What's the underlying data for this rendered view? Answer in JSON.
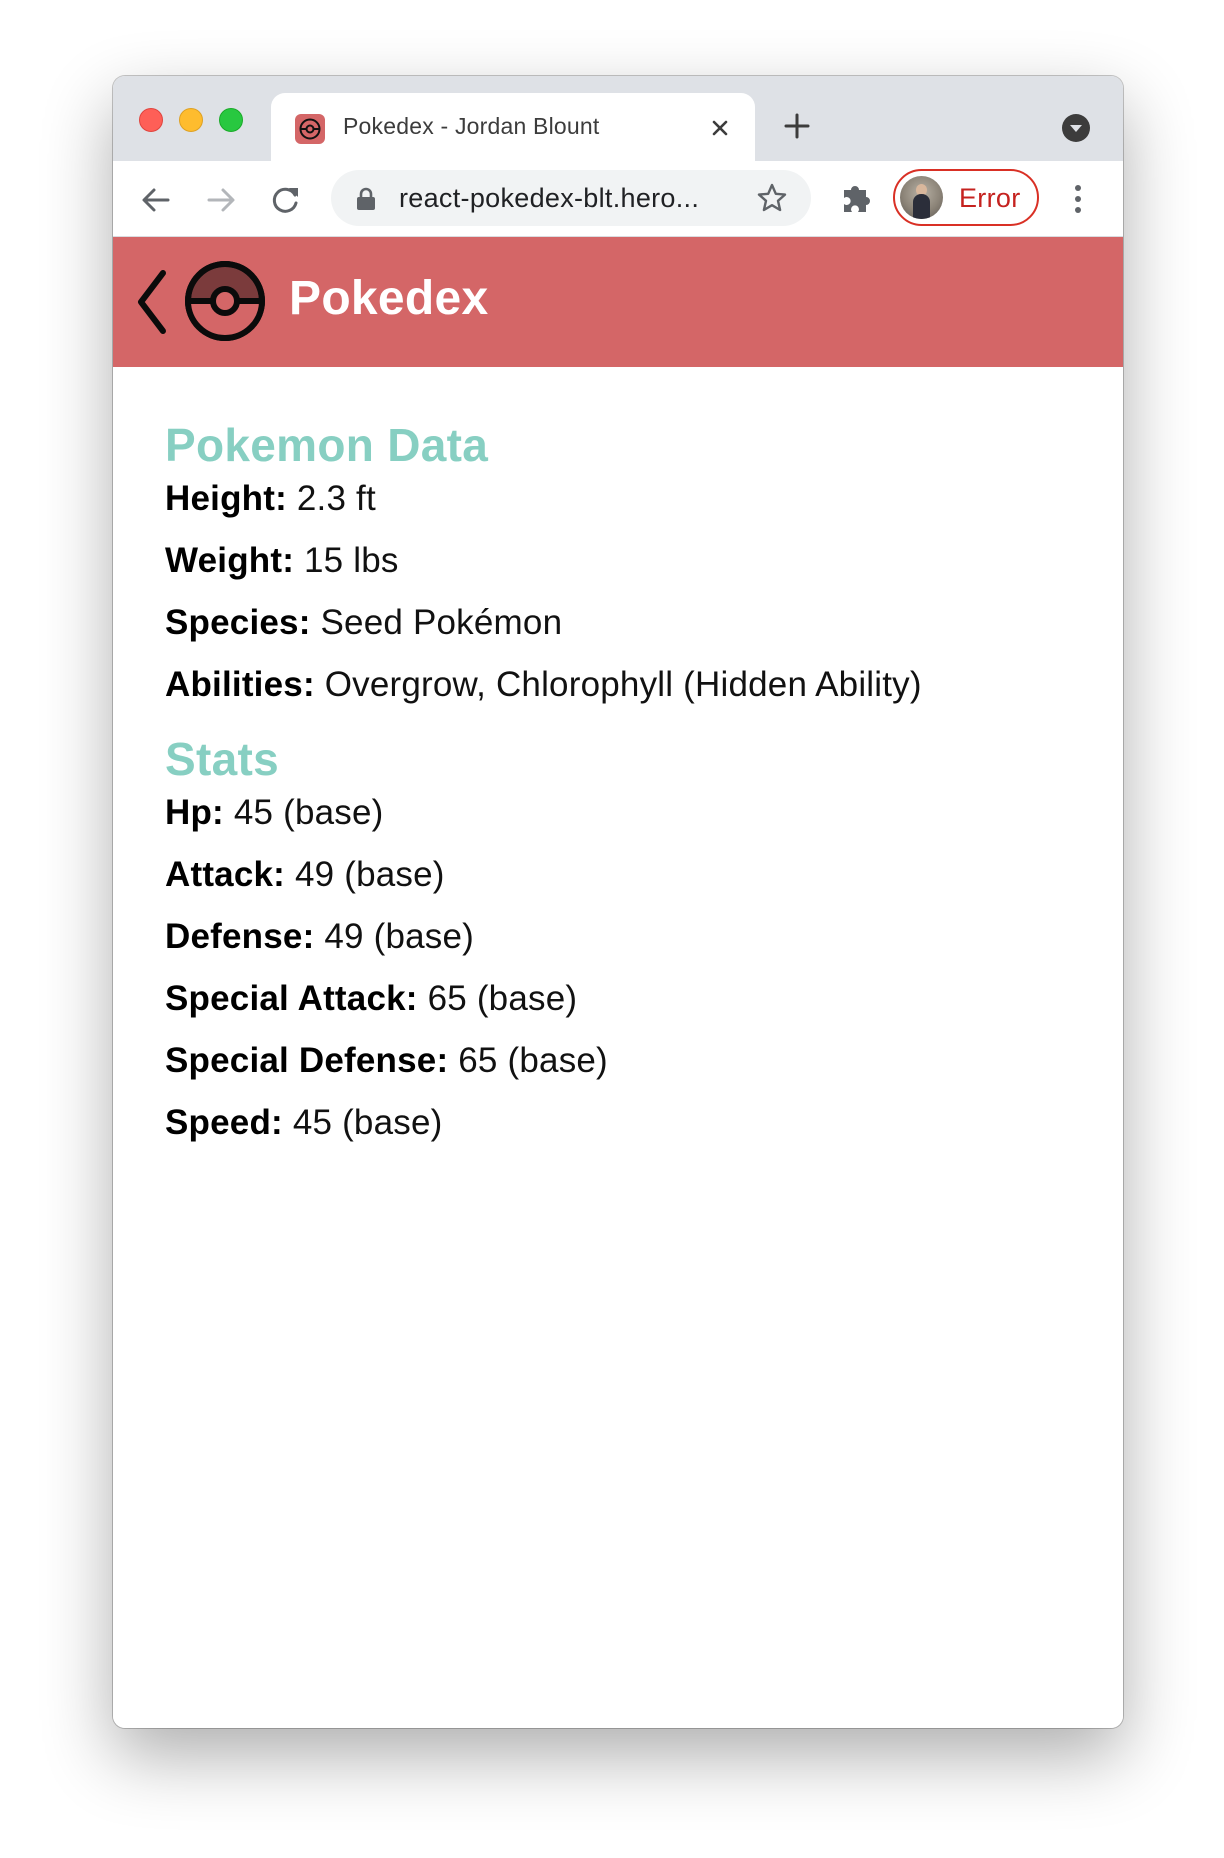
{
  "browser": {
    "tab_title": "Pokedex - Jordan Blount",
    "url": "react-pokedex-blt.hero...",
    "profile_label": "Error"
  },
  "app": {
    "title": "Pokedex",
    "header_color": "#d46667",
    "heading_color": "#87cfc2"
  },
  "pokemon_data": {
    "heading": "Pokemon Data",
    "rows": [
      {
        "label": "Height:",
        "value": " 2.3 ft"
      },
      {
        "label": "Weight:",
        "value": " 15 lbs"
      },
      {
        "label": "Species:",
        "value": " Seed Pokémon"
      },
      {
        "label": "Abilities:",
        "value": " Overgrow, Chlorophyll (Hidden Ability)"
      }
    ]
  },
  "stats": {
    "heading": "Stats",
    "rows": [
      {
        "label": "Hp:",
        "value": " 45 (base)"
      },
      {
        "label": "Attack:",
        "value": " 49 (base)"
      },
      {
        "label": "Defense:",
        "value": " 49 (base)"
      },
      {
        "label": "Special Attack:",
        "value": " 65 (base)"
      },
      {
        "label": "Special Defense:",
        "value": " 65 (base)"
      },
      {
        "label": "Speed:",
        "value": " 45 (base)"
      }
    ]
  },
  "icons": {
    "back": "chevron-left-icon",
    "logo": "pokeball-icon",
    "reload": "reload-icon",
    "extensions": "puzzle-icon"
  }
}
